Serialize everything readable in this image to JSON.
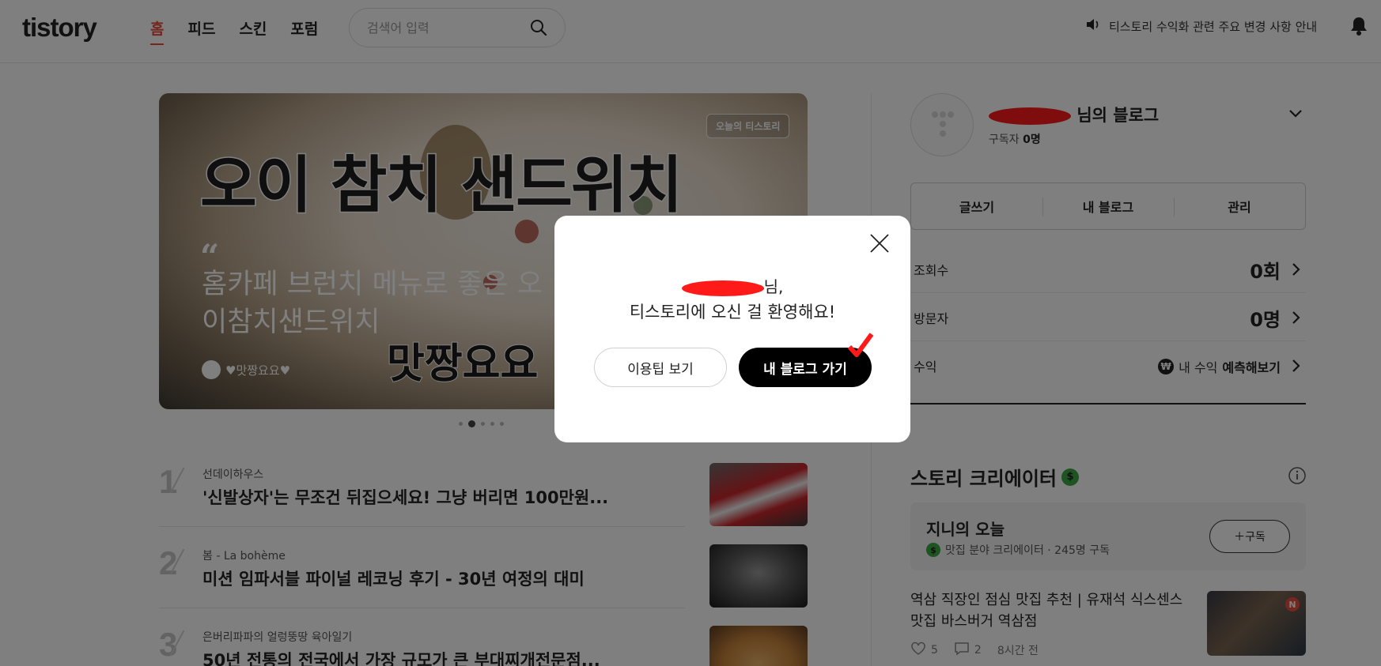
{
  "header": {
    "logo": "tistory",
    "nav": [
      "홈",
      "피드",
      "스킨",
      "포럼"
    ],
    "search_placeholder": "검색어 입력",
    "notice": "티스토리 수익화 관련 주요 변경 사항 안내"
  },
  "banner": {
    "title": "오이 참치 샌드위치",
    "quote": "“",
    "description": "홈카페 브런치 메뉴로 좋은 오이참치샌드위치",
    "author": "♥맛짱요요♥",
    "big_text": "맛짱요요",
    "badge": "오늘의 티스토리",
    "slide_total": 5,
    "slide_active": 2
  },
  "ranking": [
    {
      "num": "1",
      "blog": "선데이하우스",
      "title": "'신발상자'는 무조건 뒤집으세요! 그냥 버리면 100만원...",
      "color": "#c9262b"
    },
    {
      "num": "2",
      "blog": "봄 - La bohème",
      "title": "미션 임파서블 파이널 레코닝 후기 - 30년 여정의 대미",
      "color": "#2c2c2c"
    },
    {
      "num": "3",
      "blog": "은버리파파의 얼렁뚱땅 육아일기",
      "title": "50년 전통의 전국에서 가장 규모가 큰 부대찌개전문점...",
      "color": "#c8833b"
    }
  ],
  "profile": {
    "name_suffix": "님의 블로그",
    "subscribers_label": "구독자",
    "subscribers_value": "0명",
    "actions": [
      "글쓰기",
      "내 블로그",
      "관리"
    ],
    "stats": [
      {
        "label": "조회수",
        "value": "0회"
      },
      {
        "label": "방문자",
        "value": "0명"
      }
    ],
    "revenue_label": "수익",
    "revenue_text": "내 수익",
    "revenue_action": "예측해보기"
  },
  "story_creator": {
    "title": "스토리 크리에이터",
    "card_name": "지니의 오늘",
    "card_desc": "맛집 분야 크리에이터 · 245명 구독",
    "subscribe_label": "＋구독",
    "post_title": "역삼 직장인 점심 맛집 추천 | 유재석 식스센스 맛집 바스버거 역삼점",
    "likes": "5",
    "comments": "2",
    "time": "8시간 전"
  },
  "modal": {
    "line1_suffix": "님,",
    "line2": "티스토리에 오신 걸 환영해요!",
    "tip_button": "이용팁 보기",
    "go_button": "내 블로그 가기"
  }
}
